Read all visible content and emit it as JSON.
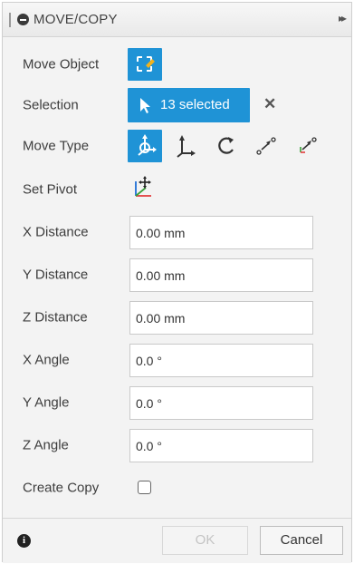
{
  "window": {
    "title": "MOVE/COPY",
    "expand_glyph": "▸▸"
  },
  "rows": {
    "move_object": {
      "label": "Move Object",
      "icon": "select-body-icon"
    },
    "selection": {
      "label": "Selection",
      "value": "13 selected",
      "clear_glyph": "✕"
    },
    "move_type": {
      "label": "Move Type",
      "options": [
        "free-move",
        "translate",
        "rotate",
        "point-to-point",
        "point-to-position"
      ],
      "active": "free-move"
    },
    "set_pivot": {
      "label": "Set Pivot",
      "icon": "pivot-axes-icon"
    },
    "x_distance": {
      "label": "X Distance",
      "value": "0.00 mm"
    },
    "y_distance": {
      "label": "Y Distance",
      "value": "0.00 mm"
    },
    "z_distance": {
      "label": "Z Distance",
      "value": "0.00 mm"
    },
    "x_angle": {
      "label": "X Angle",
      "value": "0.0 °"
    },
    "y_angle": {
      "label": "Y Angle",
      "value": "0.0 °"
    },
    "z_angle": {
      "label": "Z Angle",
      "value": "0.0 °"
    },
    "create_copy": {
      "label": "Create Copy",
      "checked": false
    }
  },
  "footer": {
    "info_glyph": "i",
    "ok_label": "OK",
    "cancel_label": "Cancel",
    "ok_enabled": false
  },
  "colors": {
    "accent": "#1f93d6",
    "panel_bg": "#f3f3f3",
    "pivot_red": "#e23b3b",
    "pivot_green": "#3aa13a",
    "pivot_blue": "#1f6fd6"
  }
}
